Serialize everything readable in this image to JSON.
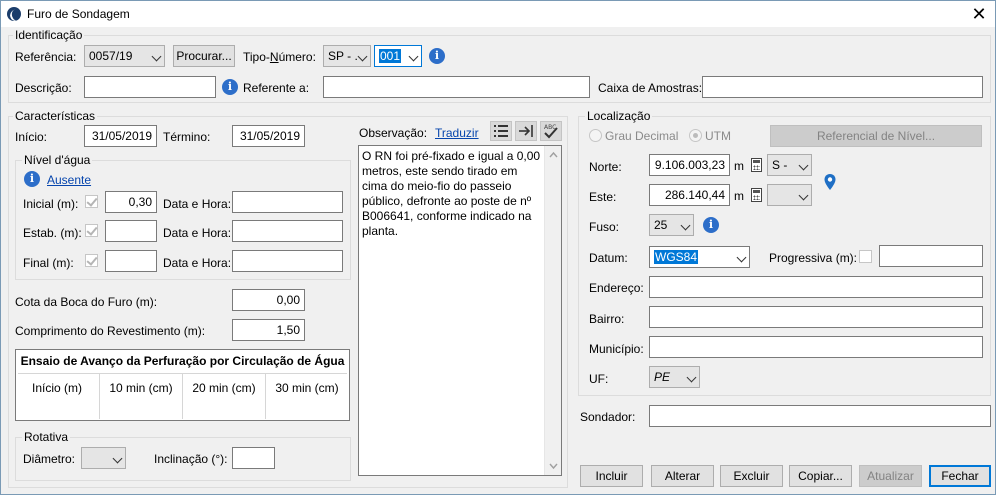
{
  "window": {
    "title": "Furo de Sondagem",
    "close": "✕"
  },
  "identificacao": {
    "group_title": "Identificação",
    "referencia_label": "Referência:",
    "referencia_value": "0057/19",
    "procurar_label": "Procurar...",
    "tipo_numero_prefix": "Tipo-",
    "tipo_numero_underline": "N",
    "tipo_numero_suffix": "úmero:",
    "tipo_value": "SP - .",
    "numero_value": "001",
    "descricao_label": "Descrição:",
    "descricao_value": "",
    "referente_label": "Referente a:",
    "referente_value": "",
    "caixa_label": "Caixa de Amostras:",
    "caixa_value": ""
  },
  "caracteristicas": {
    "group_title": "Características",
    "inicio_label": "Início:",
    "inicio_value": "31/05/2019",
    "termino_label": "Término:",
    "termino_value": "31/05/2019",
    "nivel_agua": {
      "group_title": "Nível d'água",
      "ausente_link": "Ausente",
      "inicial_label": "Inicial (m):",
      "inicial_value": "0,30",
      "estab_label": "Estab. (m):",
      "estab_value": "",
      "final_label": "Final (m):",
      "final_value": "",
      "data_hora_label": "Data e Hora:"
    },
    "cota_label": "Cota da Boca do Furo (m):",
    "cota_value": "0,00",
    "comprimento_label": "Comprimento do Revestimento (m):",
    "comprimento_value": "1,50",
    "ensaio": {
      "title": "Ensaio de Avanço da Perfuração por Circulação de Água",
      "columns": [
        "Início (m)",
        "10 min (cm)",
        "20 min (cm)",
        "30 min (cm)"
      ]
    },
    "rotativa": {
      "group_title": "Rotativa",
      "diametro_label": "Diâmetro:",
      "diametro_value": "",
      "inclinacao_label": "Inclinação (°):",
      "inclinacao_value": ""
    }
  },
  "observacao": {
    "label": "Observação:",
    "traduzir_link": "Traduzir",
    "text": "O RN foi pré-fixado e igual a 0,00 metros, este sendo tirado em cima do meio-fio do passeio público, defronte ao poste de nº B006641, conforme indicado na planta."
  },
  "localizacao": {
    "group_title": "Localização",
    "grau_decimal_label": "Grau Decimal",
    "utm_label": "UTM",
    "referencial_button": "Referencial de Nível...",
    "norte_label": "Norte:",
    "norte_value": "9.106.003,23",
    "norte_unit": "m",
    "norte_hemisphere": "S -",
    "este_label": "Este:",
    "este_value": "286.140,44",
    "este_unit": "m",
    "este_combo": "",
    "fuso_label": "Fuso:",
    "fuso_value": "25",
    "datum_label": "Datum:",
    "datum_value": "WGS84",
    "progressiva_label": "Progressiva (m):",
    "progressiva_value": "",
    "endereco_label": "Endereço:",
    "endereco_value": "",
    "bairro_label": "Bairro:",
    "bairro_value": "",
    "municipio_label": "Município:",
    "municipio_value": "",
    "uf_label": "UF:",
    "uf_value": "PE"
  },
  "sondador": {
    "label": "Sondador:",
    "value": ""
  },
  "buttons": {
    "incluir": "Incluir",
    "alterar": "Alterar",
    "excluir": "Excluir",
    "copiar": "Copiar...",
    "atualizar": "Atualizar",
    "fechar": "Fechar"
  },
  "colors": {
    "accent": "#0078d7",
    "info": "#2d6ec9",
    "link": "#0645ad",
    "map_pin": "#1f6fc5"
  }
}
